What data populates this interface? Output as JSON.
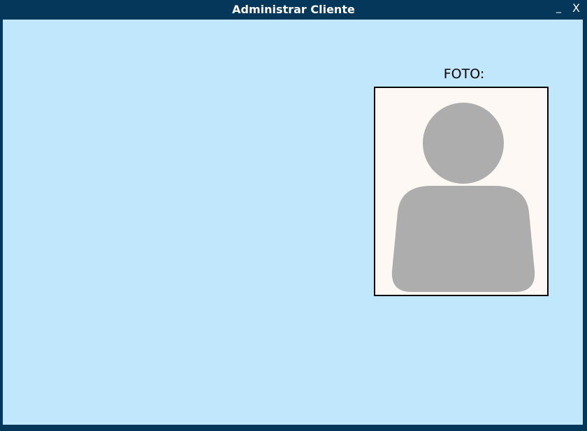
{
  "window": {
    "title": "Administrar Cliente",
    "minimize_label": "_",
    "close_label": "X"
  },
  "photo": {
    "label": "FOTO:",
    "placeholder_icon": "user-silhouette-icon"
  },
  "colors": {
    "titlebar": "#04375a",
    "content_background": "#c1e7fc",
    "photo_background": "#fdf8f3",
    "silhouette": "#adadad"
  }
}
